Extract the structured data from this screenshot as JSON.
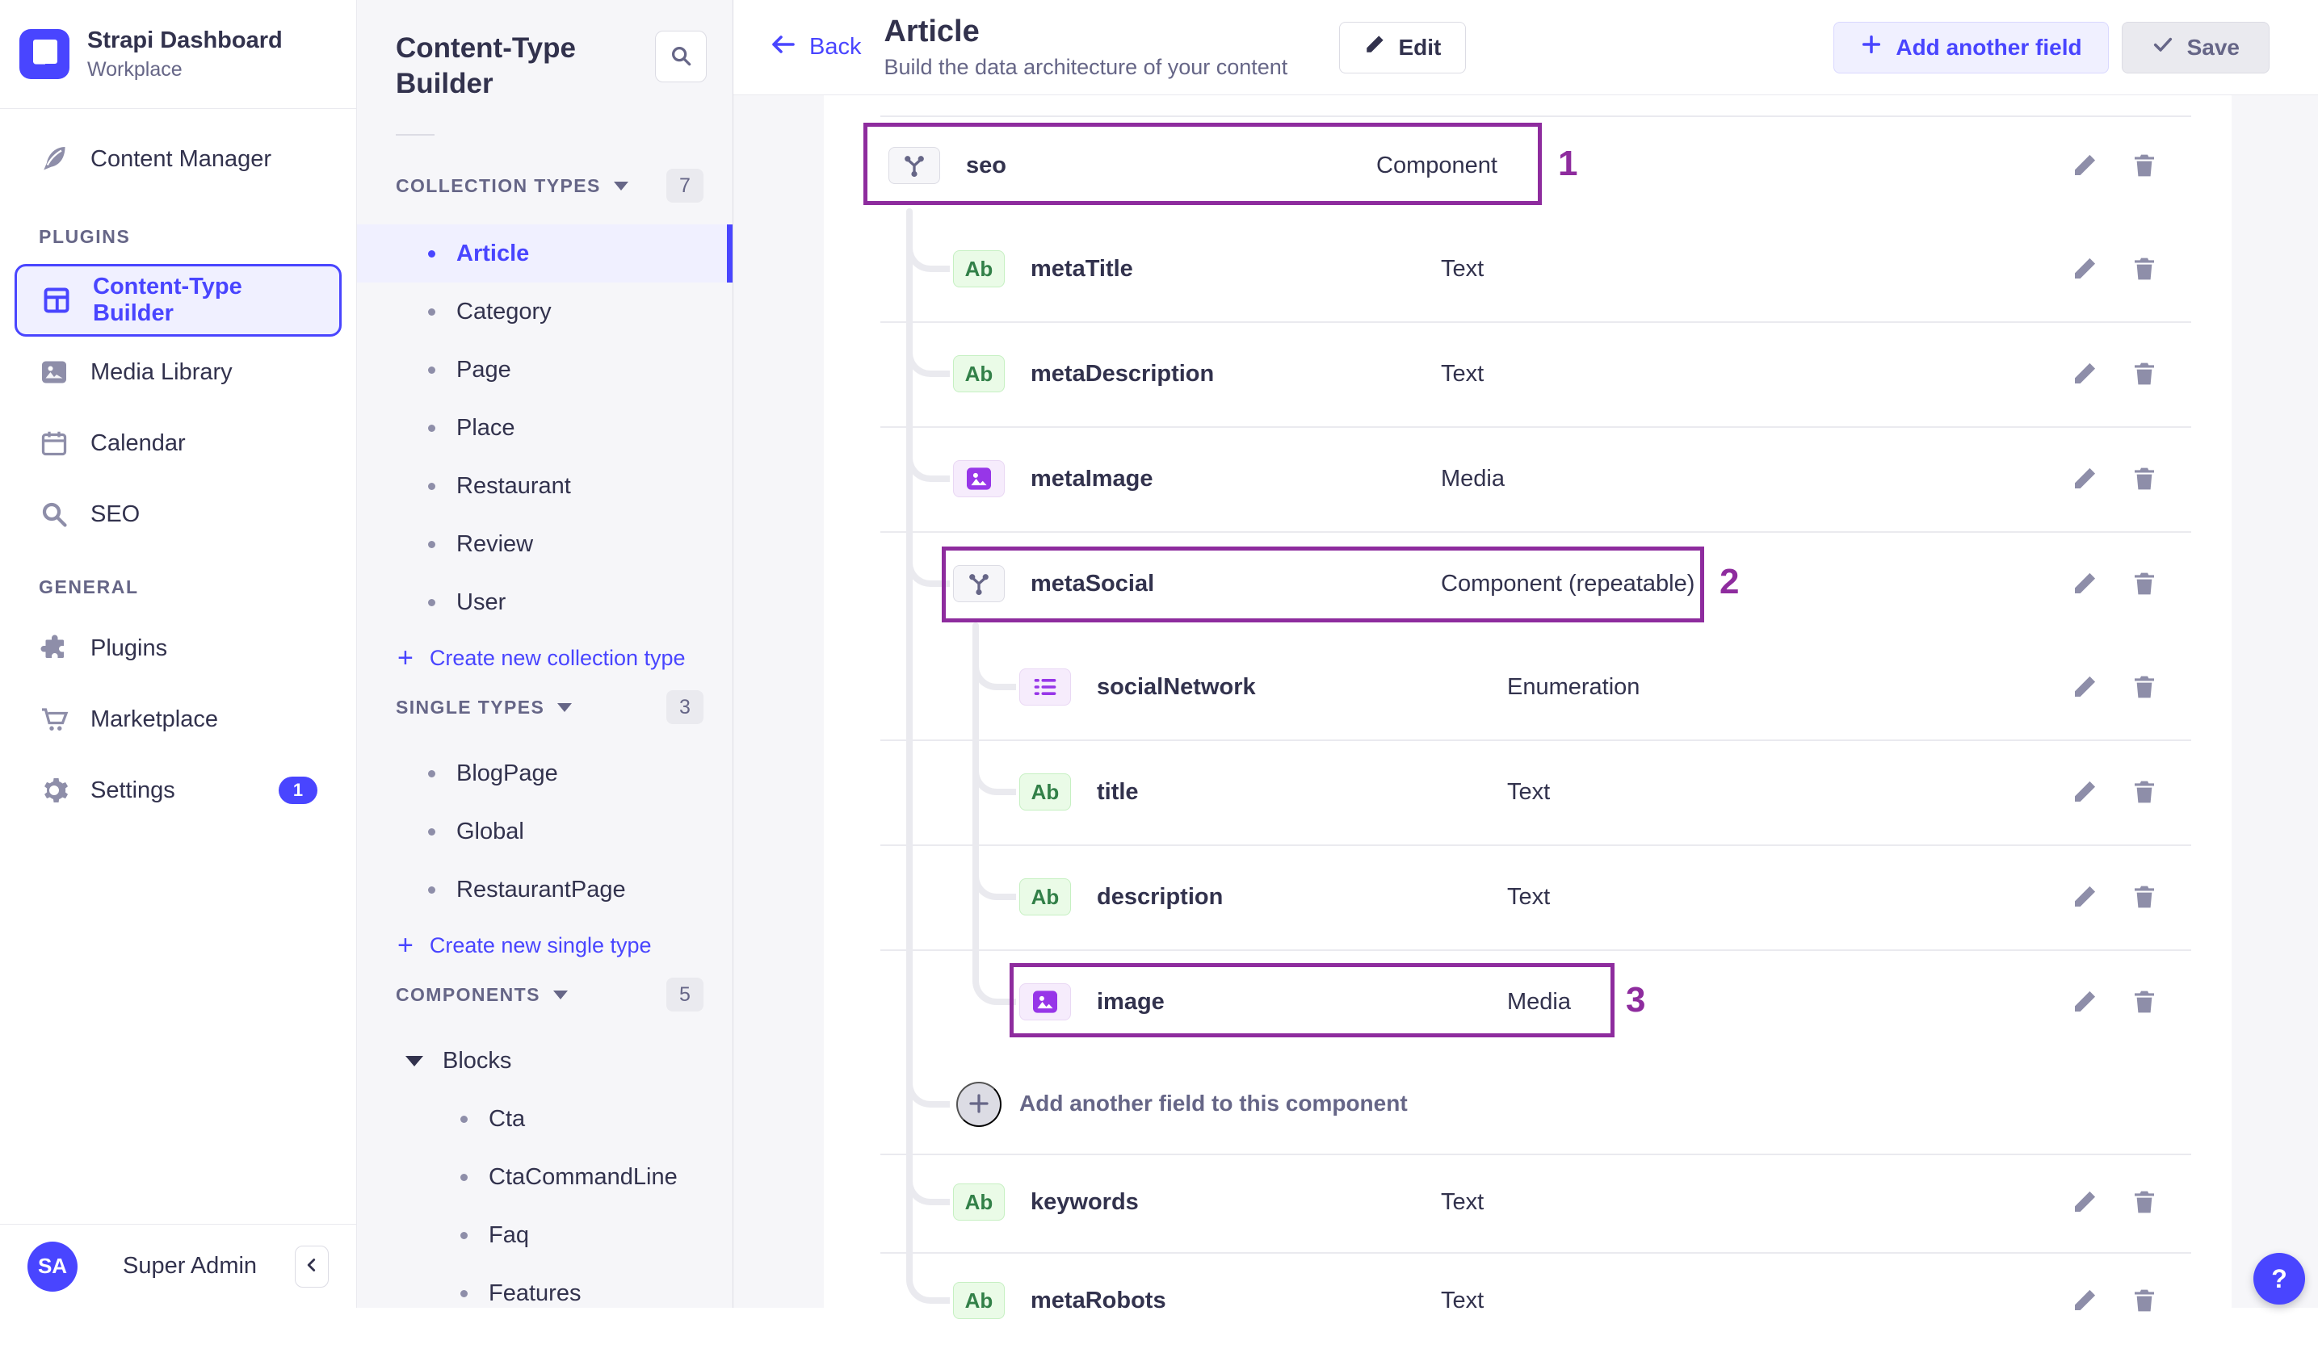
{
  "brand": {
    "name": "Strapi Dashboard",
    "workspace": "Workplace"
  },
  "sidebar": {
    "content_manager": "Content Manager",
    "plugins_header": "PLUGINS",
    "plugin_items": [
      {
        "label": "Content-Type Builder",
        "active": true
      },
      {
        "label": "Media Library"
      },
      {
        "label": "Calendar"
      },
      {
        "label": "SEO"
      }
    ],
    "general_header": "GENERAL",
    "general_items": [
      {
        "label": "Plugins"
      },
      {
        "label": "Marketplace"
      },
      {
        "label": "Settings",
        "badge": "1"
      }
    ],
    "user": {
      "initials": "SA",
      "name": "Super Admin"
    }
  },
  "subnav": {
    "title": "Content-Type Builder",
    "collection_header": "COLLECTION TYPES",
    "collection_count": "7",
    "collection_items": [
      "Article",
      "Category",
      "Page",
      "Place",
      "Restaurant",
      "Review",
      "User"
    ],
    "active_item": "Article",
    "create_collection": "Create new collection type",
    "single_header": "SINGLE TYPES",
    "single_count": "3",
    "single_items": [
      "BlogPage",
      "Global",
      "RestaurantPage"
    ],
    "create_single": "Create new single type",
    "components_header": "COMPONENTS",
    "components_count": "5",
    "component_group": "Blocks",
    "component_items": [
      "Cta",
      "CtaCommandLine",
      "Faq",
      "Features"
    ]
  },
  "header": {
    "back": "Back",
    "title": "Article",
    "subtitle": "Build the data architecture of your content",
    "edit": "Edit",
    "add_field": "Add another field",
    "save": "Save"
  },
  "fields": [
    {
      "name": "seo",
      "type": "Component",
      "badge": "component",
      "annotation": "1"
    },
    {
      "name": "metaTitle",
      "type": "Text",
      "badge": "text"
    },
    {
      "name": "metaDescription",
      "type": "Text",
      "badge": "text"
    },
    {
      "name": "metaImage",
      "type": "Media",
      "badge": "media"
    },
    {
      "name": "metaSocial",
      "type": "Component (repeatable)",
      "badge": "component",
      "annotation": "2"
    },
    {
      "name": "socialNetwork",
      "type": "Enumeration",
      "badge": "enumeration"
    },
    {
      "name": "title",
      "type": "Text",
      "badge": "text"
    },
    {
      "name": "description",
      "type": "Text",
      "badge": "text"
    },
    {
      "name": "image",
      "type": "Media",
      "badge": "media",
      "annotation": "3"
    },
    {
      "name": "keywords",
      "type": "Text",
      "badge": "text"
    },
    {
      "name": "metaRobots",
      "type": "Text",
      "badge": "text"
    }
  ],
  "labels": {
    "text_badge": "Ab",
    "add_component_field": "Add another field to this component",
    "help": "?"
  },
  "icons": {
    "search": "magnifier",
    "edit": "pencil",
    "delete": "trash",
    "back": "arrow-left",
    "component": "branch-y",
    "media": "picture",
    "enumeration": "bullet-list",
    "add": "plus",
    "save": "check",
    "collapse": "chevron-left",
    "help": "question-mark"
  },
  "colors": {
    "accent": "#4945ff",
    "accent_bg": "#f0f0ff",
    "annotation": "#8e2c9e",
    "green_badge_text": "#328048",
    "green_badge_bg": "#eafbe7",
    "purple_icon": "#9736e8",
    "purple_badge_bg": "#f6ecfc",
    "page_bg": "#f6f6f9",
    "border": "#eaeaef",
    "text_dark": "#32324d",
    "text_gray": "#666687"
  }
}
